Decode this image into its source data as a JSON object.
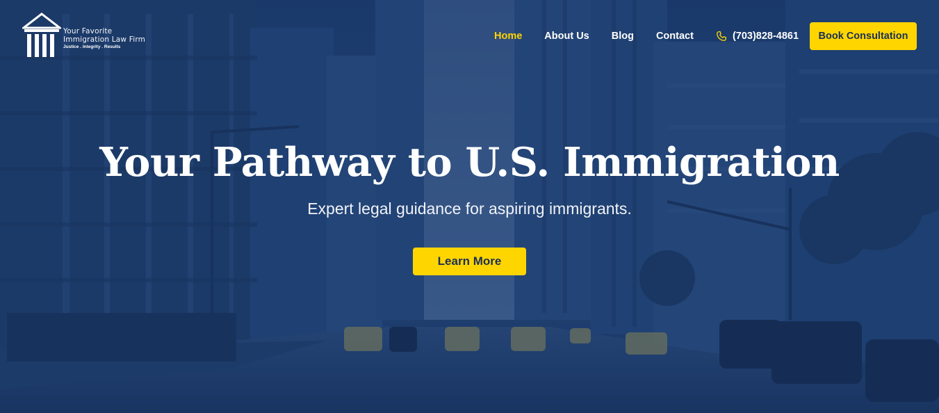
{
  "logo": {
    "line1": "Your Favorite",
    "line2": "Immigration Law Firm",
    "tagline": "Justice . Integrity . Results",
    "icon": "courthouse-pillars-icon"
  },
  "nav": {
    "items": [
      {
        "label": "Home",
        "active": true
      },
      {
        "label": "About Us",
        "active": false
      },
      {
        "label": "Blog",
        "active": false
      },
      {
        "label": "Contact",
        "active": false
      }
    ],
    "phone": {
      "icon": "phone-icon",
      "number": "(703)828-4861"
    },
    "cta_label": "Book Consultation"
  },
  "hero": {
    "title": "Your Pathway to U.S. Immigration",
    "subtitle": "Expert legal guidance for aspiring immigrants.",
    "button_label": "Learn More"
  },
  "colors": {
    "accent": "#ffd500",
    "overlay": "#1f4277",
    "button_text": "#1b2f55",
    "text": "#ffffff"
  }
}
